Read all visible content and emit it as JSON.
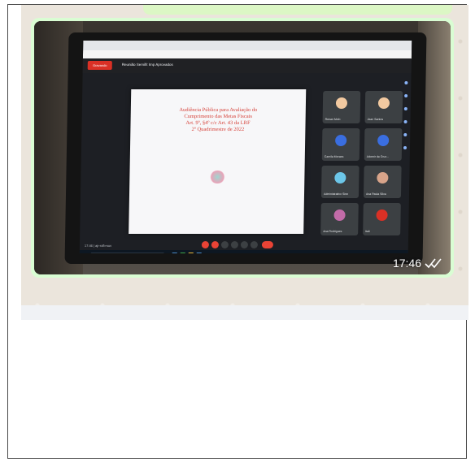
{
  "message": {
    "time": "17:46",
    "status_icon": "double-check-icon",
    "bubble_color": "#d9fdd3"
  },
  "photo": {
    "meet_header_title": "Reunião Semifit Imp Aprovados",
    "record_label": "Gravando",
    "slide": {
      "lines": [
        "Audiência Pública para Avaliação do",
        "Cumprimento das Metas Fiscais",
        "Art. 9º, §4º c/c Art. 43 da LRF",
        "2º Quadrimestre de 2022"
      ],
      "text_color": "#d6423a"
    },
    "participants": [
      {
        "name": "Renan Melo",
        "avatar_color": "#f2c9a0"
      },
      {
        "name": "Jean Santos",
        "avatar_color": "#f2c9a0"
      },
      {
        "name": "Camila Moraes",
        "avatar_color": "#3a6ee0"
      },
      {
        "name": "Ademir da Cruz...",
        "avatar_color": "#3a6ee0"
      },
      {
        "name": "Administrativo Sine",
        "avatar_color": "#6cc6e8"
      },
      {
        "name": "Ana Paula Silva",
        "avatar_color": "#d8a48a"
      },
      {
        "name": "Ana Rodrigues",
        "avatar_color": "#c26ba8"
      },
      {
        "name": "Itali",
        "avatar_color": "#d93025"
      }
    ],
    "bottom_time": "17:46 | ajr-rxfb-suv"
  }
}
